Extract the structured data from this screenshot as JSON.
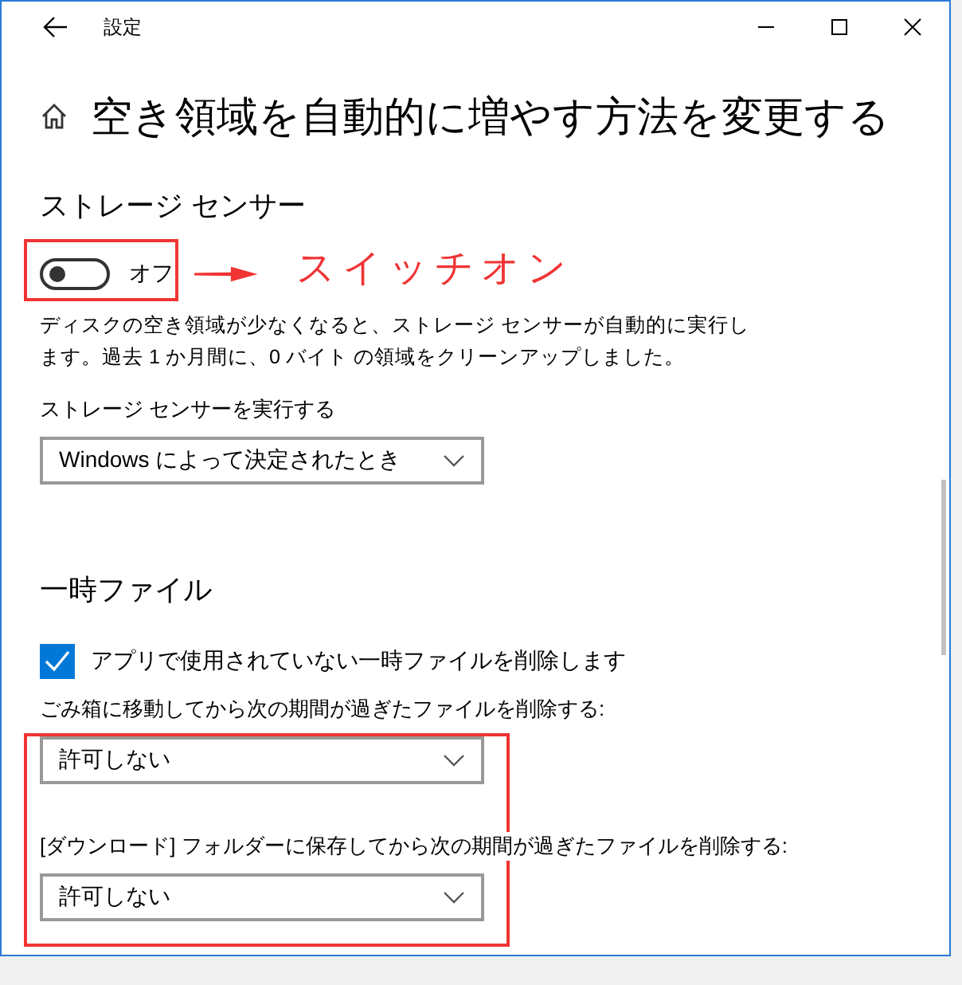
{
  "window": {
    "title": "設定"
  },
  "page_title": "空き領域を自動的に増やす方法を変更する",
  "storage_sense": {
    "heading": "ストレージ センサー",
    "toggle": {
      "on": false,
      "label": "オフ"
    },
    "description": "ディスクの空き領域が少なくなると、ストレージ センサーが自動的に実行します。過去 1 か月間に、0 バイト の領域をクリーンアップしました。",
    "run_label": "ストレージ センサーを実行する",
    "run_dropdown": {
      "value": "Windows によって決定されたとき"
    }
  },
  "temp_files": {
    "heading": "一時ファイル",
    "checkbox": {
      "label": "アプリで使用されていない一時ファイルを削除します",
      "checked": true
    },
    "dropdowns": [
      {
        "label": "ごみ箱に移動してから次の期間が過ぎたファイルを削除する:",
        "value": "許可しない"
      },
      {
        "label": "[ダウンロード] フォルダーに保存してから次の期間が過ぎたファイルを削除する:",
        "value": "許可しない"
      }
    ]
  },
  "annotation": {
    "text": "スイッチオン"
  }
}
